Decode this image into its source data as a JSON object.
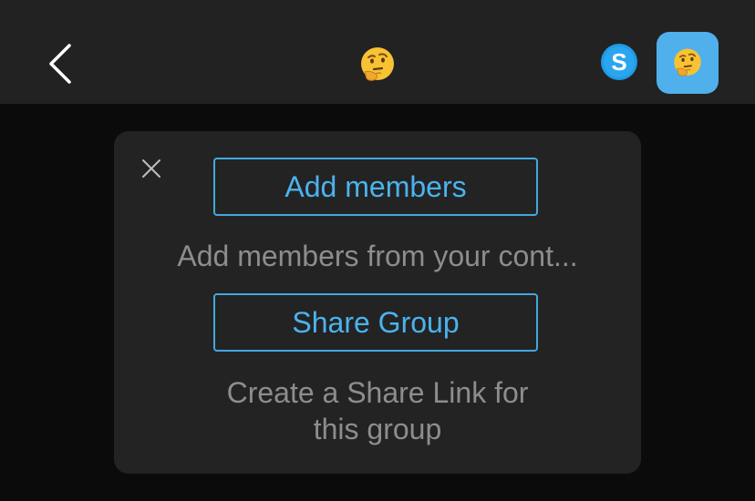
{
  "header": {
    "back_icon": "chevron-left-icon",
    "title_icon": "thinking-face-emoji",
    "skype_icon": "skype-logo-icon",
    "avatar_icon": "thinking-face-emoji"
  },
  "card": {
    "close_icon": "close-icon",
    "add_members_label": "Add members",
    "add_members_desc": "Add members from your cont...",
    "share_group_label": "Share Group",
    "share_group_desc_line1": "Create a Share Link for",
    "share_group_desc_line2": "this group"
  },
  "colors": {
    "header_bg": "#222222",
    "page_bg": "#0b0b0b",
    "card_bg": "#232323",
    "accent": "#4ab3ee",
    "avatar_bg": "#4fb0ec",
    "muted_text": "#8d8d8d"
  }
}
